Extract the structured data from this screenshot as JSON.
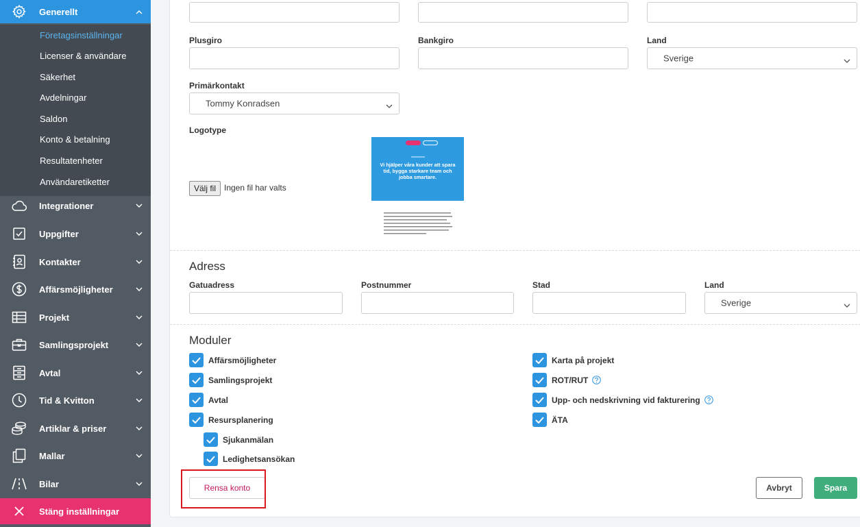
{
  "sidebar": {
    "active_section": "Generellt",
    "sub_items": [
      "Företagsinställningar",
      "Licenser & användare",
      "Säkerhet",
      "Avdelningar",
      "Saldon",
      "Konto & betalning",
      "Resultatenheter",
      "Användaretiketter"
    ],
    "sections": [
      {
        "label": "Integrationer",
        "icon": "cloud-icon"
      },
      {
        "label": "Uppgifter",
        "icon": "checkbox-icon"
      },
      {
        "label": "Kontakter",
        "icon": "contact-card-icon"
      },
      {
        "label": "Affärsmöjligheter",
        "icon": "dollar-circle-icon"
      },
      {
        "label": "Projekt",
        "icon": "table-icon"
      },
      {
        "label": "Samlingsprojekt",
        "icon": "briefcase-icon"
      },
      {
        "label": "Avtal",
        "icon": "archive-icon"
      },
      {
        "label": "Tid & Kvitton",
        "icon": "clock-icon"
      },
      {
        "label": "Artiklar & priser",
        "icon": "coins-icon"
      },
      {
        "label": "Mallar",
        "icon": "copy-icon"
      },
      {
        "label": "Bilar",
        "icon": "road-icon"
      }
    ],
    "close_label": "Stäng inställningar"
  },
  "company": {
    "plusgiro_label": "Plusgiro",
    "plusgiro_value": "",
    "bankgiro_label": "Bankgiro",
    "bankgiro_value": "",
    "country_label": "Land",
    "country_value": "Sverige",
    "primary_contact_label": "Primärkontakt",
    "primary_contact_value": "Tommy Konradsen",
    "logo_label": "Logotype",
    "file_button": "Välj fil",
    "file_status": "Ingen fil har valts",
    "logo_headline": "Vi hjälper våra kunder att spara tid, bygga starkare team och jobba smartare."
  },
  "address": {
    "title": "Adress",
    "street_label": "Gatuadress",
    "postal_label": "Postnummer",
    "city_label": "Stad",
    "country_label": "Land",
    "country_value": "Sverige"
  },
  "modules": {
    "title": "Moduler",
    "left": [
      {
        "label": "Affärsmöjligheter",
        "checked": true
      },
      {
        "label": "Samlingsprojekt",
        "checked": true
      },
      {
        "label": "Avtal",
        "checked": true
      },
      {
        "label": "Resursplanering",
        "checked": true
      }
    ],
    "sub": [
      {
        "label": "Sjukanmälan",
        "checked": true
      },
      {
        "label": "Ledighetsansökan",
        "checked": true
      }
    ],
    "right": [
      {
        "label": "Karta på projekt",
        "checked": true
      },
      {
        "label": "ROT/RUT",
        "checked": true,
        "help": true
      },
      {
        "label": "Upp- och nedskrivning vid fakturering",
        "checked": true,
        "help": true
      },
      {
        "label": "ÄTA",
        "checked": true
      }
    ]
  },
  "actions": {
    "reset_label": "Rensa konto",
    "cancel_label": "Avbryt",
    "save_label": "Spara"
  },
  "colors": {
    "accent": "#2d94e0",
    "sidebar": "#525a63",
    "danger": "#e8316f",
    "save": "#3fae7c"
  }
}
